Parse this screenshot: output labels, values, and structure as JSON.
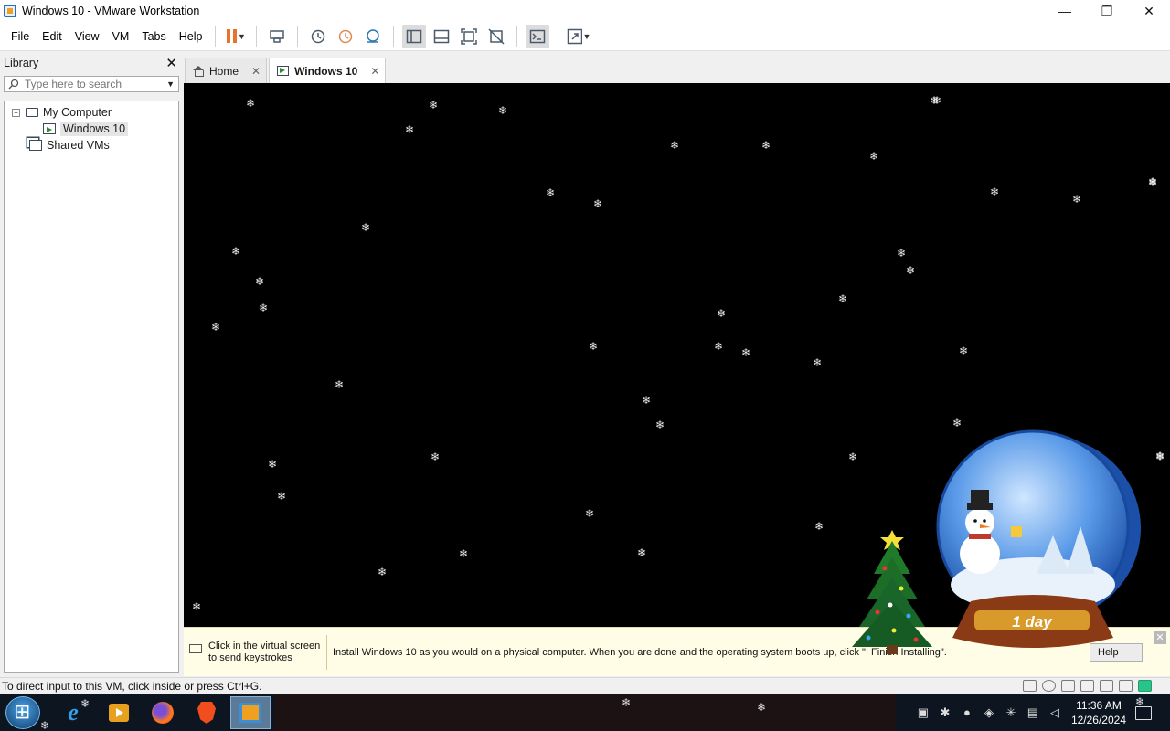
{
  "window": {
    "title": "Windows 10 - VMware Workstation",
    "controls": [
      "—",
      "❐",
      "✕"
    ]
  },
  "menu": [
    "File",
    "Edit",
    "View",
    "VM",
    "Tabs",
    "Help"
  ],
  "library": {
    "title": "Library",
    "close": "✕",
    "search_placeholder": "Type here to search",
    "tree": {
      "root": "My Computer",
      "vm": "Windows 10",
      "shared": "Shared VMs"
    }
  },
  "tabs": [
    {
      "label": "Home",
      "close": "✕"
    },
    {
      "label": "Windows 10",
      "close": "✕"
    }
  ],
  "info_bar": {
    "keyboard_hint_line1": "Click in the virtual screen",
    "keyboard_hint_line2": "to send keystrokes",
    "install_text": "Install Windows 10 as you would on a physical computer. When you are done and the operating system boots up, click \"I Finish   Installing\".",
    "help_label": "Help",
    "close": "✕"
  },
  "status": {
    "text": "To direct input to this VM, click inside or press Ctrl+G."
  },
  "taskbar": {
    "time": "11:36 AM",
    "date": "12/26/2024"
  },
  "decoration": {
    "globe_label": "1 day",
    "icons": [
      "christmas-tree",
      "snow-globe",
      "snowman"
    ],
    "colors": {
      "vm_bg": "#000000",
      "info_bg": "#fffde6",
      "taskbar": "#0d1620",
      "pause": "#e8732b"
    }
  }
}
